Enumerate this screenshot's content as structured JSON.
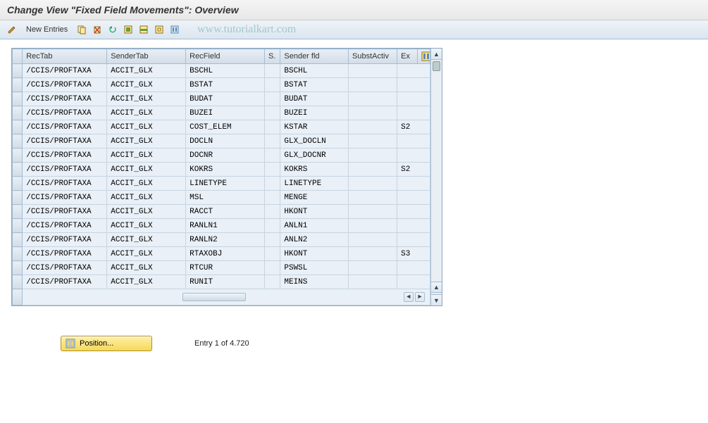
{
  "title": "Change View \"Fixed Field Movements\": Overview",
  "watermark": "www.tutorialkart.com",
  "toolbar": {
    "new_entries": "New Entries"
  },
  "columns": {
    "rectab": "RecTab",
    "sendertab": "SenderTab",
    "recfield": "RecField",
    "s": "S.",
    "senderfld": "Sender fld",
    "substactiv": "SubstActiv",
    "ex": "Ex"
  },
  "rows": [
    {
      "rectab": "/CCIS/PROFTAXA",
      "sendertab": "ACCIT_GLX",
      "recfield": "BSCHL",
      "s": "",
      "senderfld": "BSCHL",
      "subst": "",
      "ex": ""
    },
    {
      "rectab": "/CCIS/PROFTAXA",
      "sendertab": "ACCIT_GLX",
      "recfield": "BSTAT",
      "s": "",
      "senderfld": "BSTAT",
      "subst": "",
      "ex": ""
    },
    {
      "rectab": "/CCIS/PROFTAXA",
      "sendertab": "ACCIT_GLX",
      "recfield": "BUDAT",
      "s": "",
      "senderfld": "BUDAT",
      "subst": "",
      "ex": ""
    },
    {
      "rectab": "/CCIS/PROFTAXA",
      "sendertab": "ACCIT_GLX",
      "recfield": "BUZEI",
      "s": "",
      "senderfld": "BUZEI",
      "subst": "",
      "ex": ""
    },
    {
      "rectab": "/CCIS/PROFTAXA",
      "sendertab": "ACCIT_GLX",
      "recfield": "COST_ELEM",
      "s": "",
      "senderfld": "KSTAR",
      "subst": "",
      "ex": "S2"
    },
    {
      "rectab": "/CCIS/PROFTAXA",
      "sendertab": "ACCIT_GLX",
      "recfield": "DOCLN",
      "s": "",
      "senderfld": "GLX_DOCLN",
      "subst": "",
      "ex": ""
    },
    {
      "rectab": "/CCIS/PROFTAXA",
      "sendertab": "ACCIT_GLX",
      "recfield": "DOCNR",
      "s": "",
      "senderfld": "GLX_DOCNR",
      "subst": "",
      "ex": ""
    },
    {
      "rectab": "/CCIS/PROFTAXA",
      "sendertab": "ACCIT_GLX",
      "recfield": "KOKRS",
      "s": "",
      "senderfld": "KOKRS",
      "subst": "",
      "ex": "S2"
    },
    {
      "rectab": "/CCIS/PROFTAXA",
      "sendertab": "ACCIT_GLX",
      "recfield": "LINETYPE",
      "s": "",
      "senderfld": "LINETYPE",
      "subst": "",
      "ex": ""
    },
    {
      "rectab": "/CCIS/PROFTAXA",
      "sendertab": "ACCIT_GLX",
      "recfield": "MSL",
      "s": "",
      "senderfld": "MENGE",
      "subst": "",
      "ex": ""
    },
    {
      "rectab": "/CCIS/PROFTAXA",
      "sendertab": "ACCIT_GLX",
      "recfield": "RACCT",
      "s": "",
      "senderfld": "HKONT",
      "subst": "",
      "ex": ""
    },
    {
      "rectab": "/CCIS/PROFTAXA",
      "sendertab": "ACCIT_GLX",
      "recfield": "RANLN1",
      "s": "",
      "senderfld": "ANLN1",
      "subst": "",
      "ex": ""
    },
    {
      "rectab": "/CCIS/PROFTAXA",
      "sendertab": "ACCIT_GLX",
      "recfield": "RANLN2",
      "s": "",
      "senderfld": "ANLN2",
      "subst": "",
      "ex": ""
    },
    {
      "rectab": "/CCIS/PROFTAXA",
      "sendertab": "ACCIT_GLX",
      "recfield": "RTAXOBJ",
      "s": "",
      "senderfld": "HKONT",
      "subst": "",
      "ex": "S3"
    },
    {
      "rectab": "/CCIS/PROFTAXA",
      "sendertab": "ACCIT_GLX",
      "recfield": "RTCUR",
      "s": "",
      "senderfld": "PSWSL",
      "subst": "",
      "ex": ""
    },
    {
      "rectab": "/CCIS/PROFTAXA",
      "sendertab": "ACCIT_GLX",
      "recfield": "RUNIT",
      "s": "",
      "senderfld": "MEINS",
      "subst": "",
      "ex": ""
    }
  ],
  "footer": {
    "position_label": "Position...",
    "entry_text": "Entry 1 of 4.720"
  }
}
